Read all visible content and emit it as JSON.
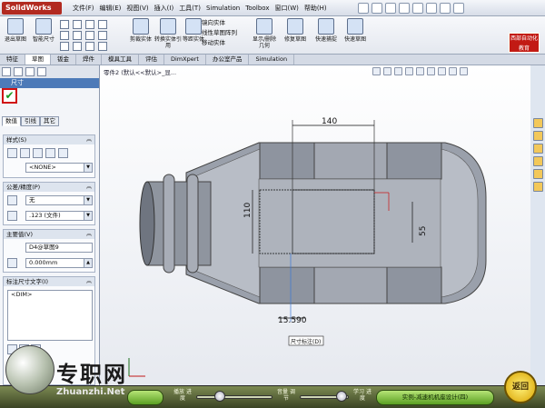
{
  "app": {
    "title": "SolidWorks"
  },
  "menus": [
    "文件(F)",
    "编辑(E)",
    "视图(V)",
    "插入(I)",
    "工具(T)",
    "Simulation",
    "Toolbox",
    "窗口(W)",
    "帮助(H)"
  ],
  "command_manager": {
    "big_buttons": [
      "退出草图",
      "智能尺寸"
    ],
    "mid_buttons": [
      "剪裁实体",
      "转换实体引用",
      "等距实体",
      "镜向实体",
      "线性草图阵列",
      "移动实体",
      "显示/删除几何",
      "修复草图",
      "快速捕捉",
      "快速草图"
    ],
    "brand": "西部自动化教育"
  },
  "tabs": [
    "特征",
    "草图",
    "评估",
    "DimXpert",
    "办公室产品",
    "Simulation"
  ],
  "tabs_extra": [
    "钣金",
    "焊件",
    "模具工具",
    "评估"
  ],
  "active_tab": "草图",
  "property_manager": {
    "title": "尺寸",
    "subtabs": [
      "数值",
      "引线",
      "其它"
    ],
    "ok_icon": "checkmark-icon",
    "style_section": "样式(S)",
    "style_value": "<NONE>",
    "tolerance_section": "公差/精度(P)",
    "tolerance_value": "无",
    "precision_value": ".123 (文件)",
    "primary_section": "主要值(V)",
    "primary_name": "D4@草图9",
    "primary_value": "0.000mm",
    "dim_text_section": "标注尺寸文字(I)",
    "dim_text_value": "<DIM>"
  },
  "graphics": {
    "breadcrumb": "零件2 (默认<<默认>_显...",
    "dims": [
      "140",
      "110",
      "55",
      "15.590"
    ],
    "tooltip": "尺寸标注(D)"
  },
  "bottom_bar": {
    "prev_label": "播放\n进度",
    "volume_label": "音量\n调节",
    "study_label": "学习\n进度",
    "lesson_title": "实例-减速机机座设计(四)",
    "return_label": "返回"
  },
  "watermark": {
    "cn": "专职网",
    "en": "Zhuanzhi.Net"
  }
}
